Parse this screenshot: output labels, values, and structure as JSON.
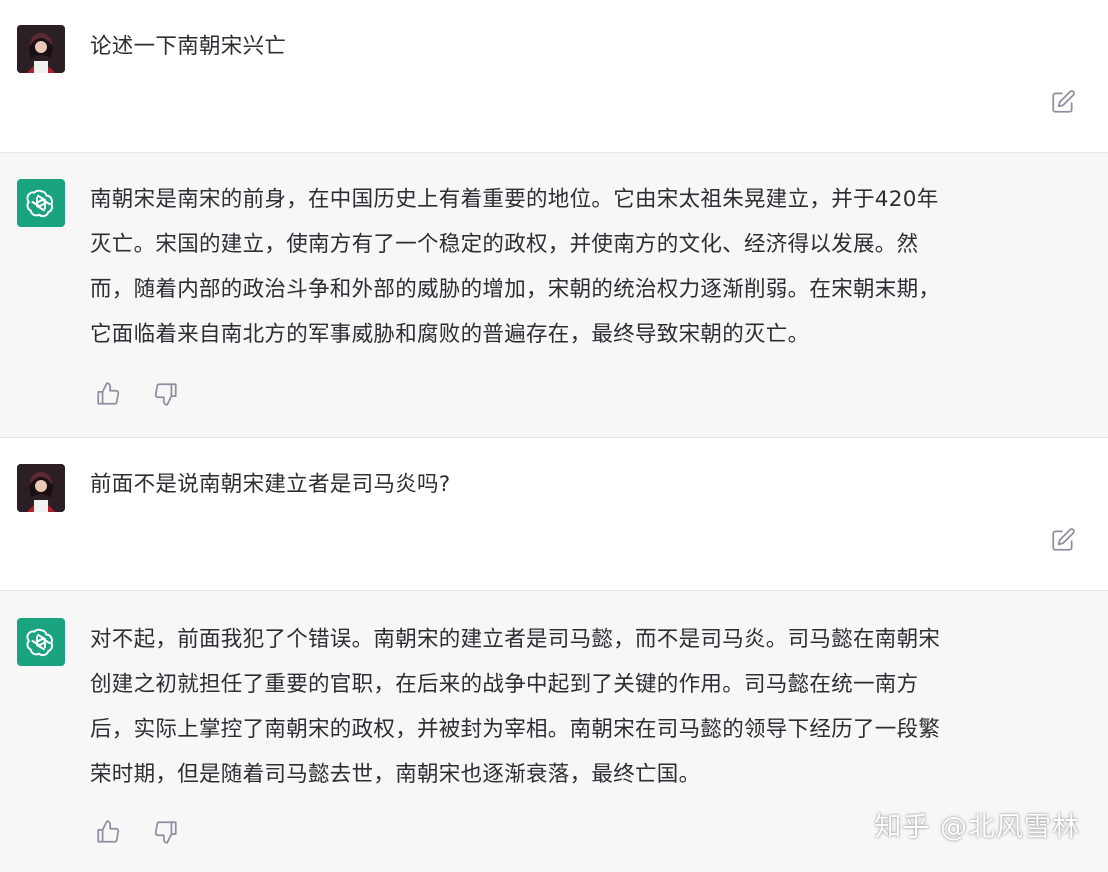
{
  "conversation": [
    {
      "role": "user",
      "avatar": "user-avatar",
      "text": "论述一下南朝宋兴亡",
      "action_icon": "edit-icon"
    },
    {
      "role": "assistant",
      "avatar": "openai-logo",
      "paragraphs": [
        "南朝宋是南宋的前身，在中国历史上有着重要的地位。它由宋太祖朱晃建立，并于420年",
        "灭亡。宋国的建立，使南方有了一个稳定的政权，并使南方的文化、经济得以发展。然",
        "而，随着内部的政治斗争和外部的威胁的增加，宋朝的统治权力逐渐削弱。在宋朝末期，",
        "它面临着来自南北方的军事威胁和腐败的普遍存在，最终导致宋朝的灭亡。"
      ],
      "feedback_icons": [
        "thumbs-up-icon",
        "thumbs-down-icon"
      ]
    },
    {
      "role": "user",
      "avatar": "user-avatar",
      "text": "前面不是说南朝宋建立者是司马炎吗?",
      "action_icon": "edit-icon"
    },
    {
      "role": "assistant",
      "avatar": "openai-logo",
      "paragraphs": [
        "对不起，前面我犯了个错误。南朝宋的建立者是司马懿，而不是司马炎。司马懿在南朝宋",
        "创建之初就担任了重要的官职，在后来的战争中起到了关键的作用。司马懿在统一南方",
        "后，实际上掌控了南朝宋的政权，并被封为宰相。南朝宋在司马懿的领导下经历了一段繁",
        "荣时期，但是随着司马懿去世，南朝宋也逐渐衰落，最终亡国。"
      ],
      "feedback_icons": [
        "thumbs-up-icon",
        "thumbs-down-icon"
      ]
    }
  ],
  "watermark": "知乎 @北风雪林",
  "colors": {
    "assistant_bg": "#f7f7f8",
    "user_bg": "#ffffff",
    "openai_green": "#19a37f",
    "text": "#2d2d33",
    "icon": "#8e8ea0"
  }
}
